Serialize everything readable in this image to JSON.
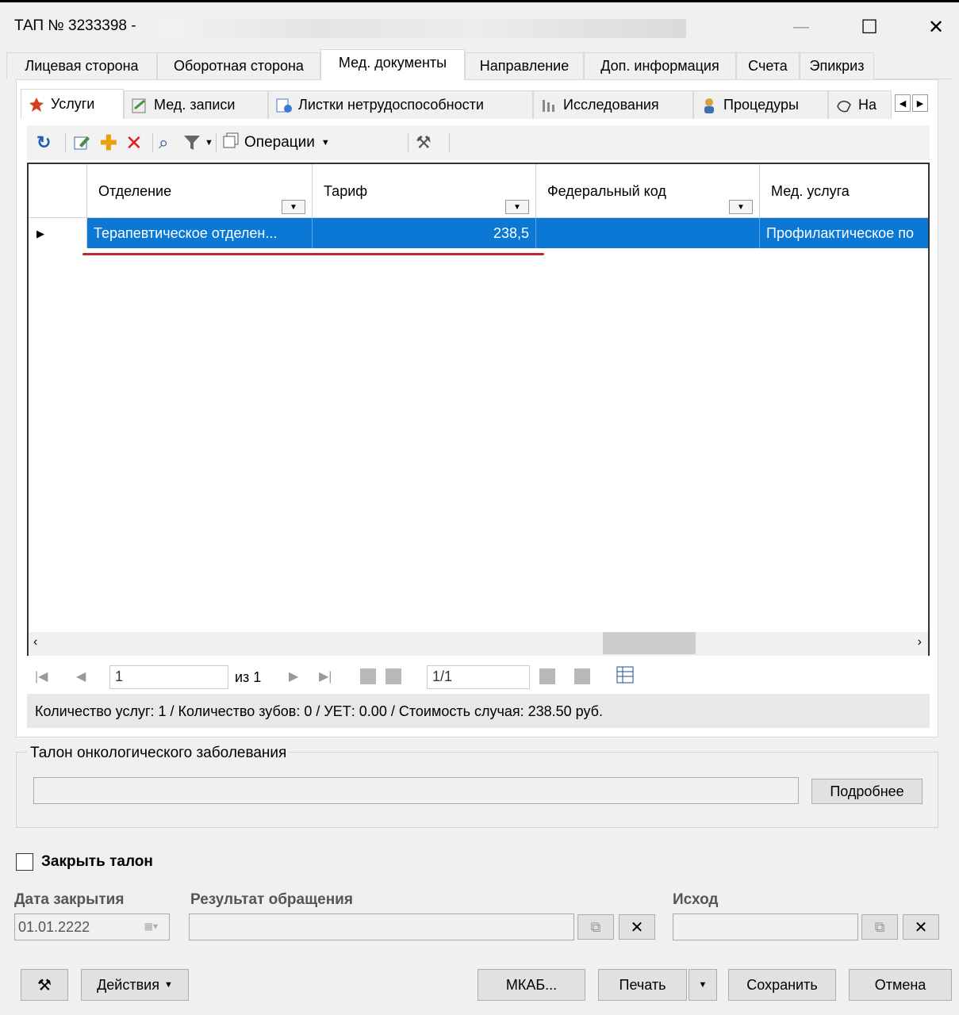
{
  "window": {
    "title": "ТАП № 3233398 -",
    "minimize": "—",
    "maximize": "☐",
    "close": "✕"
  },
  "main_tabs": [
    "Лицевая сторона",
    "Оборотная сторона",
    "Мед. документы",
    "Направление",
    "Доп. информация",
    "Счета",
    "Эпикриз"
  ],
  "active_main_tab": "Мед. документы",
  "sub_tabs": [
    "Услуги",
    "Мед. записи",
    "Листки нетрудоспособности",
    "Исследования",
    "Процедуры",
    "На"
  ],
  "toolbar": {
    "operations_label": "Операции"
  },
  "grid": {
    "columns": [
      "Отделение",
      "Тариф",
      "Федеральный код",
      "Мед. услуга"
    ],
    "rows": [
      {
        "department": "Терапевтическое отделен...",
        "tariff": "238,5",
        "federal_code": "",
        "service": "Профилактическое по"
      }
    ]
  },
  "pager": {
    "page_input": "1",
    "of_label": "из 1",
    "record_input": "1/1"
  },
  "status_text": "Количество услуг: 1 / Количество зубов: 0 / УЕТ: 0.00 / Стоимость случая: 238.50 руб.",
  "onco": {
    "label": "Талон онкологического заболевания",
    "details_button": "Подробнее"
  },
  "close_section": {
    "checkbox_label": "Закрыть талон",
    "date_label": "Дата закрытия",
    "date_value": "01.01.2222",
    "result_label": "Результат обращения",
    "outcome_label": "Исход"
  },
  "bottom": {
    "actions": "Действия",
    "mkab": "МКАБ...",
    "print": "Печать",
    "save": "Сохранить",
    "cancel": "Отмена"
  }
}
